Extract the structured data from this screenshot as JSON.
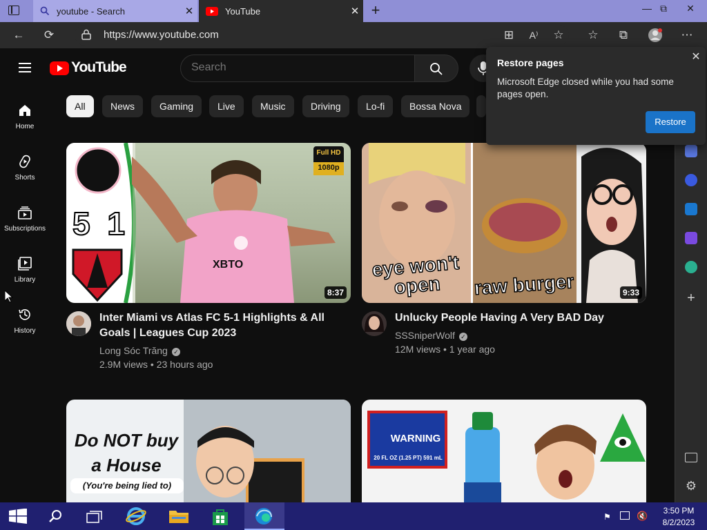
{
  "browser": {
    "tabs": [
      {
        "label": "youtube - Search"
      },
      {
        "label": "YouTube"
      }
    ],
    "url": "https://www.youtube.com",
    "win_controls": [
      "—",
      "⧉",
      "✕"
    ]
  },
  "youtube": {
    "logo_text": "YouTube",
    "search_placeholder": "Search",
    "chips": [
      "All",
      "News",
      "Gaming",
      "Live",
      "Music",
      "Driving",
      "Lo-fi",
      "Bossa Nova"
    ],
    "active_chip": "All",
    "sidebar": [
      {
        "label": "Home",
        "icon": "home-icon"
      },
      {
        "label": "Shorts",
        "icon": "shorts-icon"
      },
      {
        "label": "Subscriptions",
        "icon": "subscriptions-icon"
      },
      {
        "label": "Library",
        "icon": "library-icon"
      },
      {
        "label": "History",
        "icon": "history-icon"
      }
    ],
    "videos": [
      {
        "title_line1": "Inter Miami vs Atlas FC 5-1 Highlights & All",
        "title_line2": "Goals | Leagues Cup 2023",
        "channel": "Long Sóc Trăng",
        "meta": "2.9M views • 23 hours ago",
        "duration": "8:37",
        "thumb_text_1": "5 1",
        "thumb_badge_top": "Full HD",
        "thumb_badge_bottom": "1080p",
        "thumb_shirt": "XBTO"
      },
      {
        "title_line1": "Unlucky People Having A Very BAD Day",
        "title_line2": "",
        "channel": "SSSniperWolf",
        "meta": "12M views • 1 year ago",
        "duration": "9:33",
        "thumb_caption_left": "eye won't open",
        "thumb_caption_right": "raw burger"
      },
      {
        "thumb_line1": "Do NOT buy",
        "thumb_line2": "a House",
        "thumb_line3": "(You're being lied to)"
      },
      {
        "thumb_warning": "WARNING",
        "thumb_size": "20 FL OZ (1.25 PT) 591 mL"
      }
    ]
  },
  "restore_popup": {
    "title": "Restore pages",
    "message": "Microsoft Edge closed while you had some pages open.",
    "button": "Restore"
  },
  "taskbar": {
    "time": "3:50 PM",
    "date": "8/2/2023"
  },
  "colors": {
    "tab_strip": "#8f8fd6",
    "youtube_red": "#ff0000",
    "restore_button": "#1a73c8",
    "taskbar": "#202070"
  }
}
